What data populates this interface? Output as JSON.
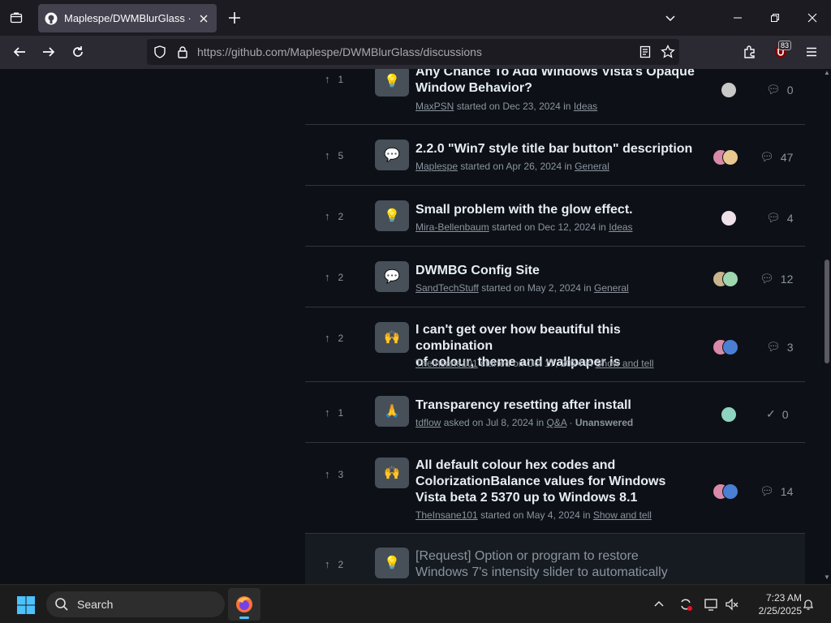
{
  "browser": {
    "tab_title": "Maplespe/DWMBlurGlass · Disc",
    "url_host": "https://github.com",
    "url_path": "/Maplespe/DWMBlurGlass/discussions",
    "extension_badge": "83"
  },
  "discussions": [
    {
      "votes": "1",
      "icon": "💡",
      "title_line1": "Any Chance To Add Windows Vista's Opaque",
      "title_line2": "Window Behavior?",
      "author": "MaxPSN",
      "verb": "started on",
      "date": "Dec 23, 2024",
      "category": "Ideas",
      "comments": "0",
      "answered": ""
    },
    {
      "votes": "5",
      "icon": "💬",
      "title_line1": "2.2.0 \"Win7 style title bar button\" description",
      "title_line2": "",
      "author": "Maplespe",
      "verb": "started on",
      "date": "Apr 26, 2024",
      "category": "General",
      "comments": "47",
      "answered": ""
    },
    {
      "votes": "2",
      "icon": "💡",
      "title_line1": "Small problem with the glow effect.",
      "title_line2": "",
      "author": "Mira-Bellenbaum",
      "verb": "started on",
      "date": "Dec 12, 2024",
      "category": "Ideas",
      "comments": "4",
      "answered": ""
    },
    {
      "votes": "2",
      "icon": "💬",
      "title_line1": "DWMBG Config Site",
      "title_line2": "",
      "author": "SandTechStuff",
      "verb": "started on",
      "date": "May 2, 2024",
      "category": "General",
      "comments": "12",
      "answered": ""
    },
    {
      "votes": "2",
      "icon": "🙌",
      "title_line1": "I can't get over how beautiful this combination",
      "title_line2": "of colour, theme and wallpaper is",
      "author": "TheInsane101",
      "verb": "started on",
      "date": "Oct 17, 2024",
      "category": "Show and tell",
      "comments": "3",
      "answered": ""
    },
    {
      "votes": "1",
      "icon": "🙏",
      "title_line1": "Transparency resetting after install",
      "title_line2": "",
      "author": "tdflow",
      "verb": "asked on",
      "date": "Jul 8, 2024",
      "category": "Q&A",
      "comments": "0",
      "answered": "Unanswered"
    },
    {
      "votes": "3",
      "icon": "🙌",
      "title_line1": "All default colour hex codes and",
      "title_line2": "ColorizationBalance values for Windows",
      "title_line3": "Vista beta 2 5370 up to Windows 8.1",
      "author": "TheInsane101",
      "verb": "started on",
      "date": "May 4, 2024",
      "category": "Show and tell",
      "comments": "14",
      "answered": ""
    },
    {
      "votes": "2",
      "icon": "💡",
      "title_line1": "[Request] Option or program to restore",
      "title_line2": "Windows 7's intensity slider to automatically",
      "author": "",
      "verb": "",
      "date": "",
      "category": "",
      "comments": "",
      "answered": ""
    }
  ],
  "taskbar": {
    "search_label": "Search",
    "time": "7:23 AM",
    "date": "2/25/2025"
  },
  "meta_in": "in"
}
